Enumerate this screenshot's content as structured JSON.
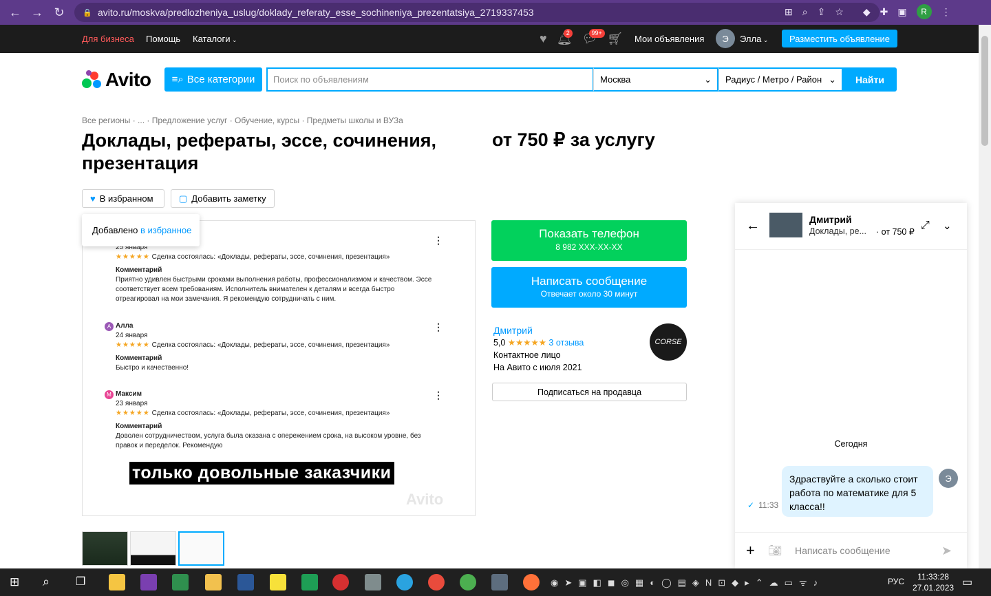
{
  "browser": {
    "url": "avito.ru/moskva/predlozheniya_uslug/doklady_referaty_esse_sochineniya_prezentatsiya_2719337453",
    "profile_initial": "R"
  },
  "topbar": {
    "for_business": "Для бизнеса",
    "help": "Помощь",
    "catalogs": "Каталоги",
    "notif_badge": "2",
    "messages_badge": "99+",
    "my_ads": "Мои объявления",
    "user_initial": "Э",
    "user_name": "Элла",
    "post_ad": "Разместить объявление"
  },
  "header": {
    "logo": "Avito",
    "all_categories": "Все категории",
    "search_placeholder": "Поиск по объявлениям",
    "city": "Москва",
    "radius": "Радиус / Метро / Район",
    "find": "Найти"
  },
  "listing": {
    "breadcrumb": "Все регионы · ... · Предложение услуг · Обучение, курсы · Предметы школы и ВУЗа",
    "title": "Доклады, рефераты, эссе, сочинения, презентация",
    "price": "от 750 ₽ за услугу",
    "in_favorites": "В избранном",
    "add_note": "Добавить заметку",
    "tooltip_text": "Добавлено",
    "tooltip_link": "в избранное"
  },
  "photo": {
    "r1_date": "25 января",
    "r1_deal": "Сделка состоялась: «Доклады, рефераты, эссе, сочинения, презентация»",
    "comment_label": "Комментарий",
    "r1_text": "Приятно удивлен быстрыми сроками выполнения работы, профессионализмом и качеством. Эссе соответствует всем требованиям. Исполнитель внимателен к деталям и всегда быстро отреагировал на мои замечания. Я рекомендую сотрудничать с ним.",
    "r2_initial": "А",
    "r2_name": "Алла",
    "r2_date": "24 января",
    "r2_deal": "Сделка состоялась: «Доклады, рефераты, эссе, сочинения, презентация»",
    "r2_text": "Быстро и качественно!",
    "r3_initial": "М",
    "r3_name": "Максим",
    "r3_date": "23 января",
    "r3_deal": "Сделка состоялась: «Доклады, рефераты, эссе, сочинения, презентация»",
    "r3_text": "Доволен сотрудничеством, услуга была оказана с опережением срока, на высоком уровне, без правок и переделок. Рекомендую",
    "caption": "только довольные заказчики",
    "watermark": "Avito"
  },
  "contact": {
    "show_phone": "Показать телефон",
    "phone_masked": "8 982 XXX-XX-XX",
    "write_message": "Написать сообщение",
    "reply_time": "Отвечает около 30 минут",
    "seller_name": "Дмитрий",
    "rating": "5,0",
    "reviews": "3 отзыва",
    "role": "Контактное лицо",
    "since": "На Авито с июля 2021",
    "seller_logo": "CORSE",
    "subscribe": "Подписаться на продавца"
  },
  "chat": {
    "name": "Дмитрий",
    "subject": "Доклады, ре...",
    "price": "· от 750 ₽",
    "date_divider": "Сегодня",
    "message": "Здраствуйте  а сколько стоит работа по математике для 5 класса!!",
    "time": "11:33",
    "my_initial": "Э",
    "input_placeholder": "Написать сообщение"
  },
  "taskbar": {
    "lang": "РУС",
    "time": "11:33:28",
    "date": "27.01.2023"
  }
}
